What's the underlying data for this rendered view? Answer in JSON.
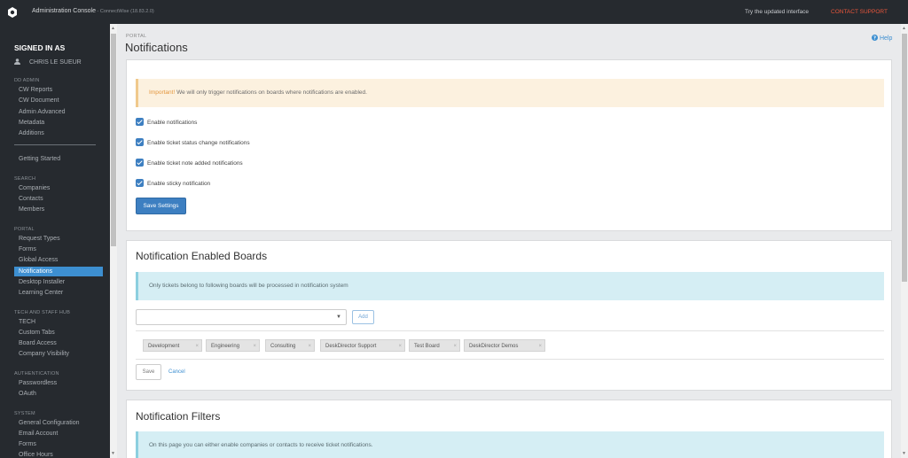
{
  "topbar": {
    "title": "Administration Console",
    "subtitle": " - ConnectWise (18.83.2.0)",
    "try_link": "Try the updated interface",
    "contact": "CONTACT SUPPORT"
  },
  "sidebar": {
    "signed_in_label": "SIGNED IN AS",
    "user": "CHRIS LE SUEUR",
    "sections": {
      "dd_admin": "DD ADMIN",
      "search": "SEARCH",
      "portal": "PORTAL",
      "tech": "TECH AND STAFF HUB",
      "auth": "AUTHENTICATION",
      "system": "SYSTEM"
    },
    "dd_admin_items": [
      "CW Reports",
      "CW Document",
      "Admin Advanced",
      "Metadata",
      "Additions"
    ],
    "getting_started": "Getting Started",
    "search_items": [
      "Companies",
      "Contacts",
      "Members"
    ],
    "portal_items": [
      "Request Types",
      "Forms",
      "Global Access",
      "Notifications",
      "Desktop Installer",
      "Learning Center"
    ],
    "tech_items": [
      "TECH",
      "Custom Tabs",
      "Board Access",
      "Company Visibility"
    ],
    "auth_items": [
      "Passwordless",
      "OAuth"
    ],
    "system_items": [
      "General Configuration",
      "Email Account",
      "Forms",
      "Office Hours"
    ]
  },
  "page": {
    "breadcrumb": "PORTAL",
    "title": "Notifications",
    "help": "Help"
  },
  "settings": {
    "alert_strong": "Important!",
    "alert_text": " We will only trigger notifications on boards where notifications are enabled.",
    "checks": [
      "Enable notifications",
      "Enable ticket status change notifications",
      "Enable ticket note added notifications",
      "Enable sticky notification"
    ],
    "save_button": "Save Settings"
  },
  "boards": {
    "title": "Notification Enabled Boards",
    "info": "Only tickets belong to following boards will be processed in notification system",
    "add_button": "Add",
    "tags": [
      "Development",
      "Engineering",
      "Consulting",
      "DeskDirector Support",
      "Test Board",
      "DeskDirector Demos"
    ],
    "tag_remove": "×",
    "save": "Save",
    "cancel": "Cancel"
  },
  "filters": {
    "title": "Notification Filters",
    "info": "On this page you can either enable companies or contacts to receive ticket notifications."
  },
  "icons": {
    "logo": "logo-icon",
    "user": "user-icon",
    "help": "help-circle-icon",
    "caret": "caret-down-icon",
    "check": "checkbox-checked-icon"
  },
  "colors": {
    "accent": "#3d7fc1",
    "active": "#3d8fd1",
    "contact": "#e8563b",
    "warning_bg": "#fcf1df",
    "info_bg": "#d5eef4"
  }
}
